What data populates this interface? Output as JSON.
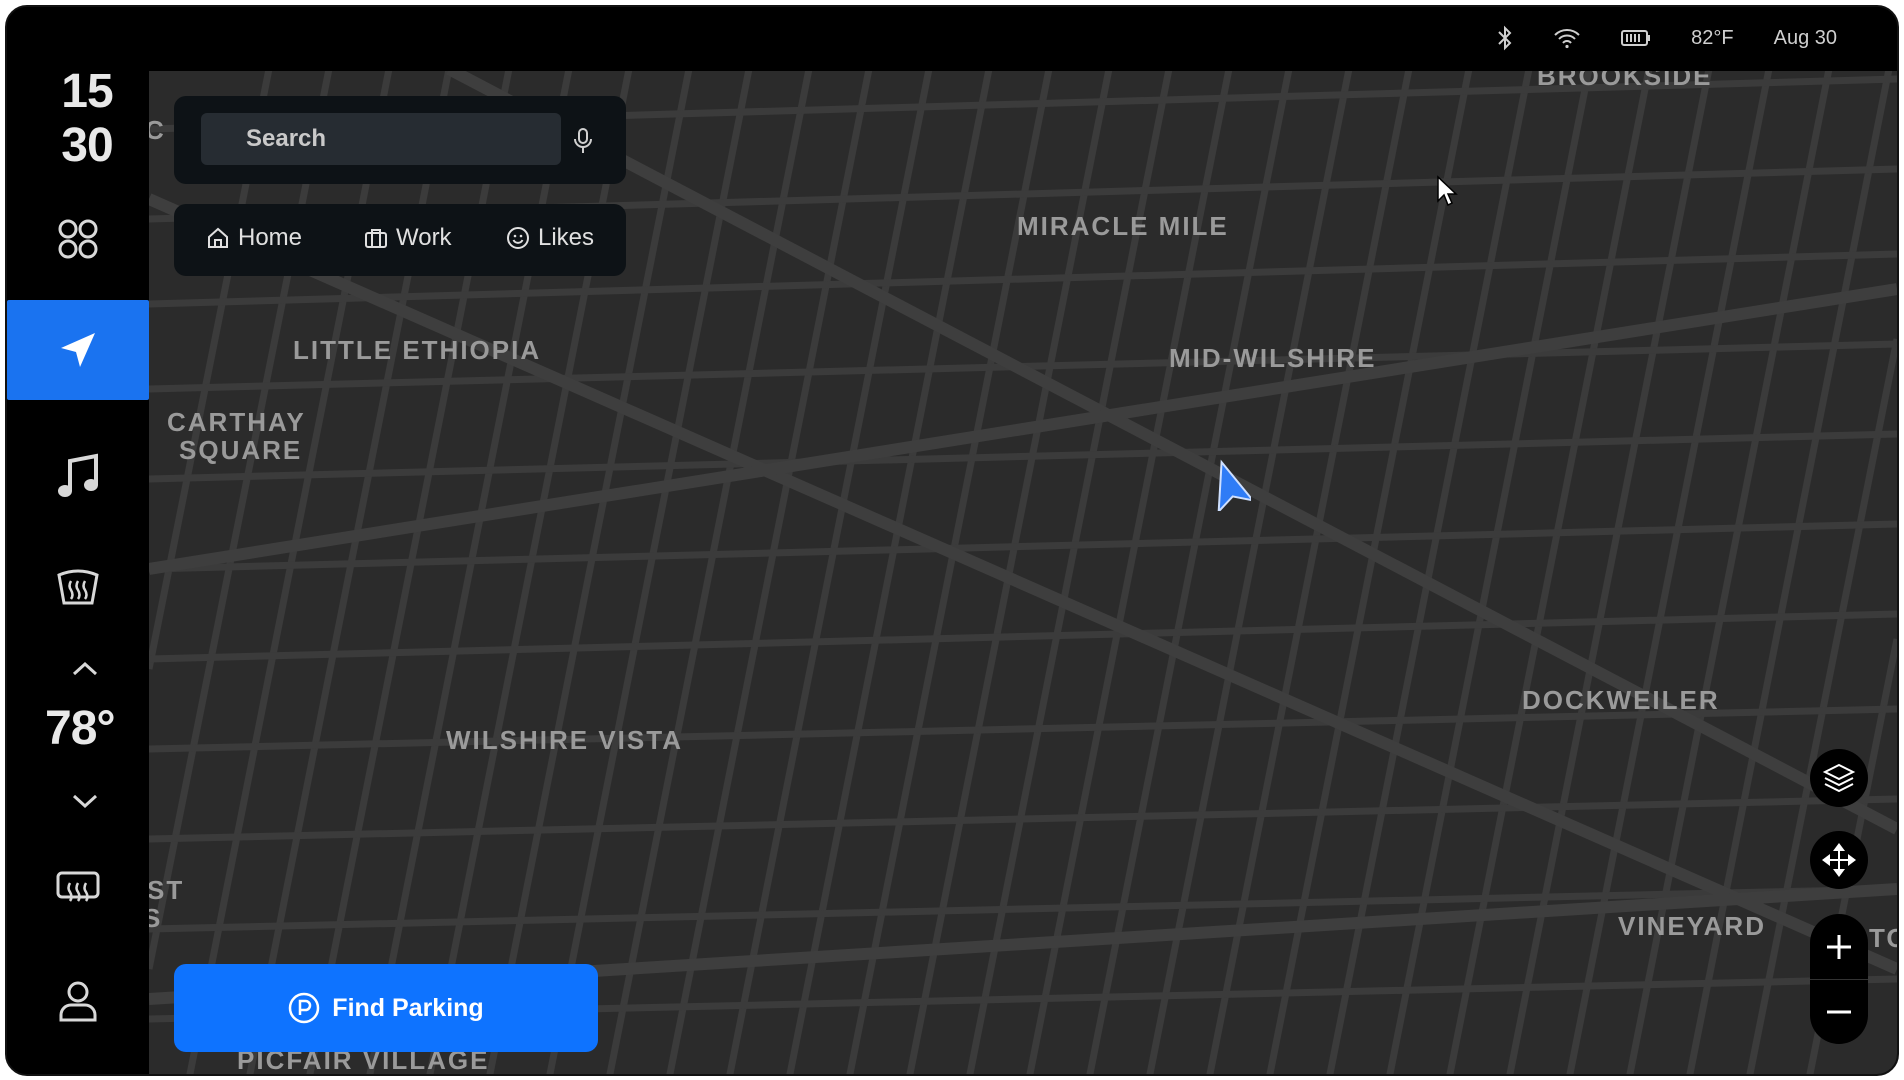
{
  "status": {
    "temperature": "82°F",
    "date": "Aug 30",
    "icons": [
      "bluetooth-icon",
      "wifi-icon",
      "battery-icon"
    ]
  },
  "sidebar": {
    "clock_hours": "15",
    "clock_minutes": "30",
    "cabin_temp": "78°",
    "items": [
      "apps-icon",
      "navigation-icon",
      "music-icon",
      "rear-defrost-icon",
      "front-defrost-icon",
      "profile-icon"
    ]
  },
  "search": {
    "placeholder": "Search"
  },
  "quick_destinations": {
    "home": "Home",
    "work": "Work",
    "likes": "Likes"
  },
  "map": {
    "places": {
      "brookside": "BROOKSIDE",
      "miracle_mile": "MIRACLE MILE",
      "mid_wilshire": "MID-WILSHIRE",
      "little_ethiopia": "LITTLE ETHIOPIA",
      "carthay_square_1": "CARTHAY",
      "carthay_square_2": "SQUARE",
      "wilshire_vista": "WILSHIRE VISTA",
      "dockweiler": "DOCKWEILER",
      "vineyard": "VINEYARD",
      "picfair_village": "PICFAIR VILLAGE",
      "cut_left_1": "ST",
      "cut_left_2": "S",
      "cut_right": "TO",
      "cut_top_left": "C"
    }
  },
  "actions": {
    "find_parking": "Find Parking"
  },
  "colors": {
    "accent": "#1a73f0",
    "map_background": "#2b2b2b",
    "street": "#3b3b3b"
  }
}
